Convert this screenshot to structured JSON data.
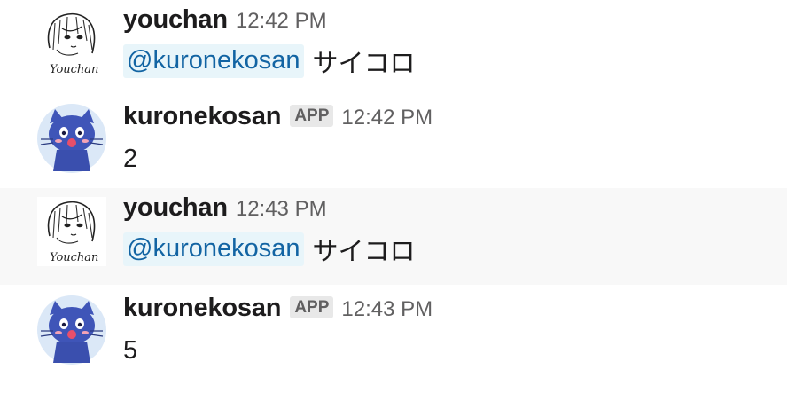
{
  "messages": [
    {
      "author": "youchan",
      "timestamp": "12:42 PM",
      "mention": "@kuronekosan",
      "text": "サイコロ",
      "avatar_icon": "manga-girl-avatar",
      "avatar_signature": "Youchan"
    },
    {
      "author": "kuronekosan",
      "badge": "APP",
      "timestamp": "12:42 PM",
      "text": "2",
      "avatar_icon": "blue-cat-avatar"
    },
    {
      "author": "youchan",
      "timestamp": "12:43 PM",
      "mention": "@kuronekosan",
      "text": "サイコロ",
      "avatar_icon": "manga-girl-avatar",
      "avatar_signature": "Youchan"
    },
    {
      "author": "kuronekosan",
      "badge": "APP",
      "timestamp": "12:43 PM",
      "text": "5",
      "avatar_icon": "blue-cat-avatar"
    }
  ],
  "colors": {
    "hover_background": "#f8f8f8",
    "mention_background": "#e8f5fa",
    "mention_text": "#1264a3",
    "badge_background": "#e8e8e8",
    "timestamp_text": "#616061",
    "cat_blue": "#3f55b8"
  }
}
